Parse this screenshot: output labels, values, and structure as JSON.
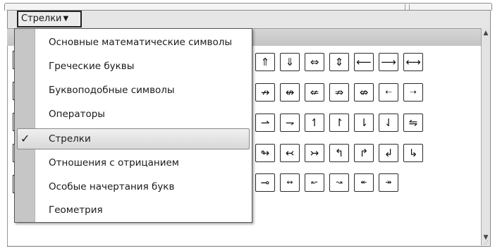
{
  "dropdown": {
    "label": "Стрелки",
    "caret": "▼"
  },
  "menu": {
    "items": [
      {
        "label": "Основные математические символы",
        "checked": false
      },
      {
        "label": "Греческие буквы",
        "checked": false
      },
      {
        "label": "Буквоподобные символы",
        "checked": false
      },
      {
        "label": "Операторы",
        "checked": false
      },
      {
        "label": "Стрелки",
        "checked": true
      },
      {
        "label": "Отношения с отрицанием",
        "checked": false
      },
      {
        "label": "Особые начертания букв",
        "checked": false
      },
      {
        "label": "Геометрия",
        "checked": false
      }
    ],
    "check_mark": "✓"
  },
  "symbols": {
    "row1": [
      "⇑",
      "⇓",
      "⇔",
      "⇕",
      "⟵",
      "⟶",
      "⟷"
    ],
    "row2": [
      "↛",
      "↮",
      "⇍",
      "⇏",
      "⇎",
      "⇠",
      "⇢"
    ],
    "row3": [
      "⇀",
      "⇁",
      "↿",
      "↾",
      "⇂",
      "⇃",
      "⇋"
    ],
    "row4": [
      "↬",
      "↢",
      "↣",
      "↰",
      "↱",
      "↲",
      "↳"
    ],
    "row5": [
      "⊸",
      "↭",
      "↜",
      "↝",
      "↞",
      "↠"
    ]
  },
  "scrollbar": {
    "up": "▲",
    "down": "▼"
  },
  "colors": {
    "menu_gutter": "#c6c6c6",
    "panel": "#e6e6e6",
    "border": "#2a2a2a"
  }
}
